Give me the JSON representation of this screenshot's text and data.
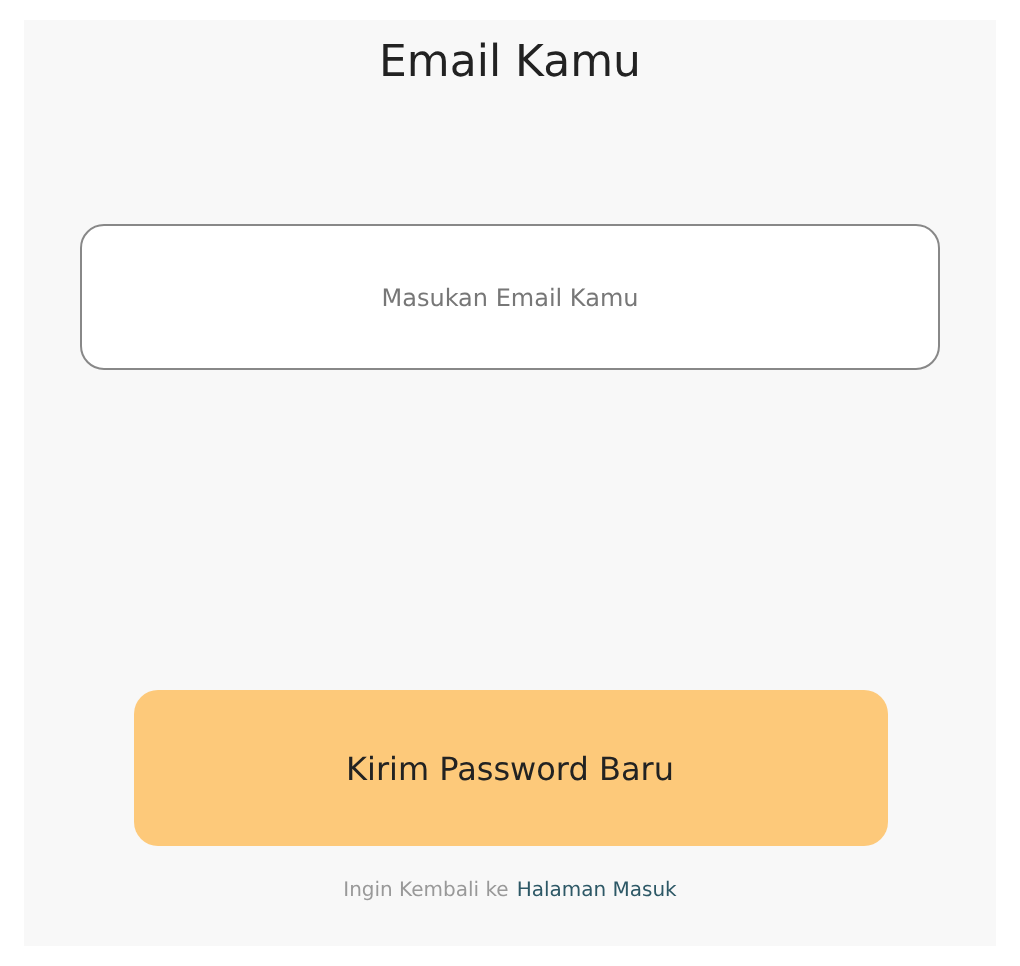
{
  "title": "Email Kamu",
  "email_field": {
    "placeholder": "Masukan Email Kamu"
  },
  "submit_button": {
    "label": "Kirim Password Baru"
  },
  "footer": {
    "text": "Ingin Kembali ke",
    "link": "Halaman Masuk"
  }
}
